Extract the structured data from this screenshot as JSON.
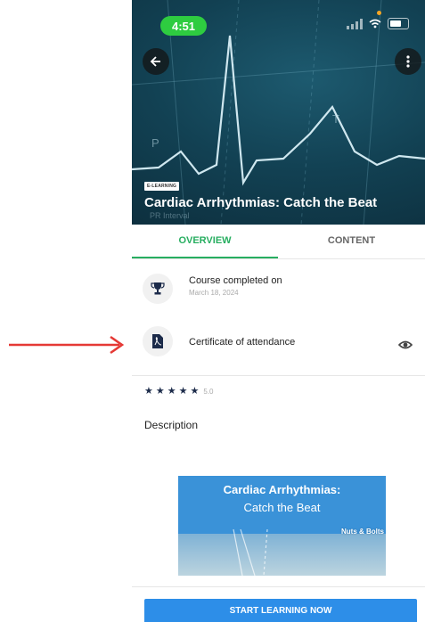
{
  "status_bar": {
    "time": "4:51"
  },
  "hero": {
    "badge": "E-LEARNING",
    "title": "Cardiac Arrhythmias: Catch the Beat",
    "back_icon": "arrow-left-icon",
    "more_icon": "more-vertical-icon"
  },
  "tabs": [
    {
      "label": "OVERVIEW",
      "active": true
    },
    {
      "label": "CONTENT",
      "active": false
    }
  ],
  "completed": {
    "title": "Course completed on",
    "date": "March 18, 2024",
    "icon": "trophy-icon"
  },
  "certificate": {
    "title": "Certificate of attendance",
    "icon": "pdf-icon",
    "action_icon": "eye-icon"
  },
  "rating": {
    "stars": 5,
    "value": "5.0"
  },
  "description": {
    "heading": "Description"
  },
  "promo": {
    "line1": "Cardiac Arrhythmias:",
    "line2": "Catch the Beat",
    "tag": "Nuts & Bolts"
  },
  "cta": {
    "label": "START LEARNING NOW"
  },
  "colors": {
    "accent_green": "#27ae60",
    "cta_blue": "#2d8ee8",
    "arrow_red": "#e53935",
    "status_green": "#2ecc40"
  }
}
